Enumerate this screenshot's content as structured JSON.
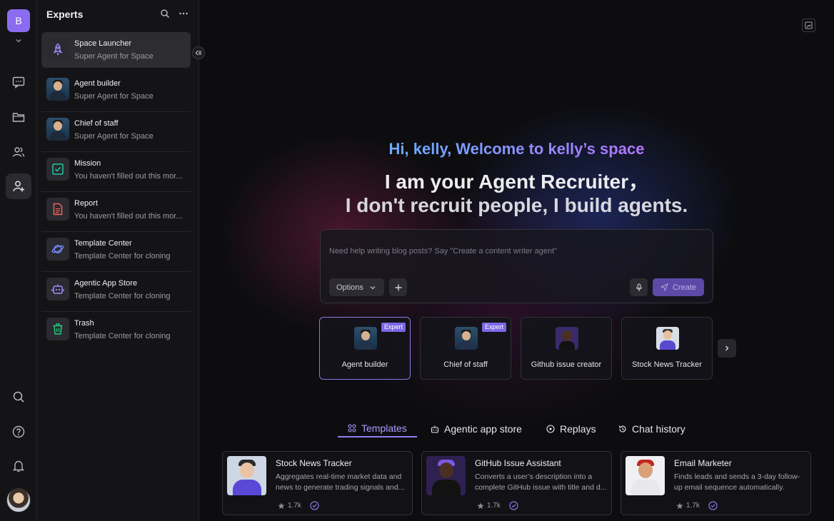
{
  "workspace": {
    "initial": "B"
  },
  "panel": {
    "title": "Experts",
    "items": [
      {
        "name": "Space Launcher",
        "sub": "Super Agent for Space",
        "icon": "rocket-icon",
        "active": true
      },
      {
        "name": "Agent builder",
        "sub": "Super Agent for Space",
        "icon": "avatar-photo"
      },
      {
        "name": "Chief of staff",
        "sub": "Super Agent for Space",
        "icon": "avatar-photo"
      },
      {
        "name": "Mission",
        "sub": "You haven't filled out this mor...",
        "icon": "checkbox-icon"
      },
      {
        "name": "Report",
        "sub": "You haven't filled out this mor...",
        "icon": "document-icon"
      },
      {
        "name": "Template Center",
        "sub": "Template Center for cloning",
        "icon": "planet-icon"
      },
      {
        "name": "Agentic App Store",
        "sub": "Template Center for cloning",
        "icon": "robot-icon"
      },
      {
        "name": "Trash",
        "sub": "Template Center for cloning",
        "icon": "trash-icon"
      }
    ]
  },
  "hero": {
    "greeting": "Hi, kelly, Welcome to kelly’s space",
    "line1": "I am your Agent Recruiter，",
    "line2": "I don't recruit people, I build agents."
  },
  "prompt": {
    "placeholder": "Need help writing blog posts? Say \"Create a content writer agent\"",
    "options_label": "Options",
    "create_label": "Create"
  },
  "agent_cards": [
    {
      "label": "Agent builder",
      "badge": "Expert",
      "selected": true
    },
    {
      "label": "Chief of staff",
      "badge": "Expert"
    },
    {
      "label": "Github issue creator",
      "badge": ""
    },
    {
      "label": "Stock News Tracker",
      "badge": ""
    }
  ],
  "tabs": [
    {
      "label": "Templates",
      "icon": "grid-icon",
      "active": true
    },
    {
      "label": "Agentic app store",
      "icon": "robot-icon"
    },
    {
      "label": "Replays",
      "icon": "play-icon"
    },
    {
      "label": "Chat history",
      "icon": "history-icon"
    }
  ],
  "templates": [
    {
      "title": "Stock News Tracker",
      "desc": "Aggregates real-time market data and news to generate trading signals and...",
      "stars": "1.7k"
    },
    {
      "title": "GitHub Issue Assistant",
      "desc": "Converts a user’s description into a complete GitHub issue with title and d...",
      "stars": "1.7k"
    },
    {
      "title": "Email Marketer",
      "desc": "Finds leads and sends a 3-day follow-up email sequence automatically.",
      "stars": "1.7k"
    }
  ],
  "colors": {
    "accent": "#8b6cf0",
    "create_button": "#5b4aa8",
    "expert_badge": "#7b68e6"
  }
}
